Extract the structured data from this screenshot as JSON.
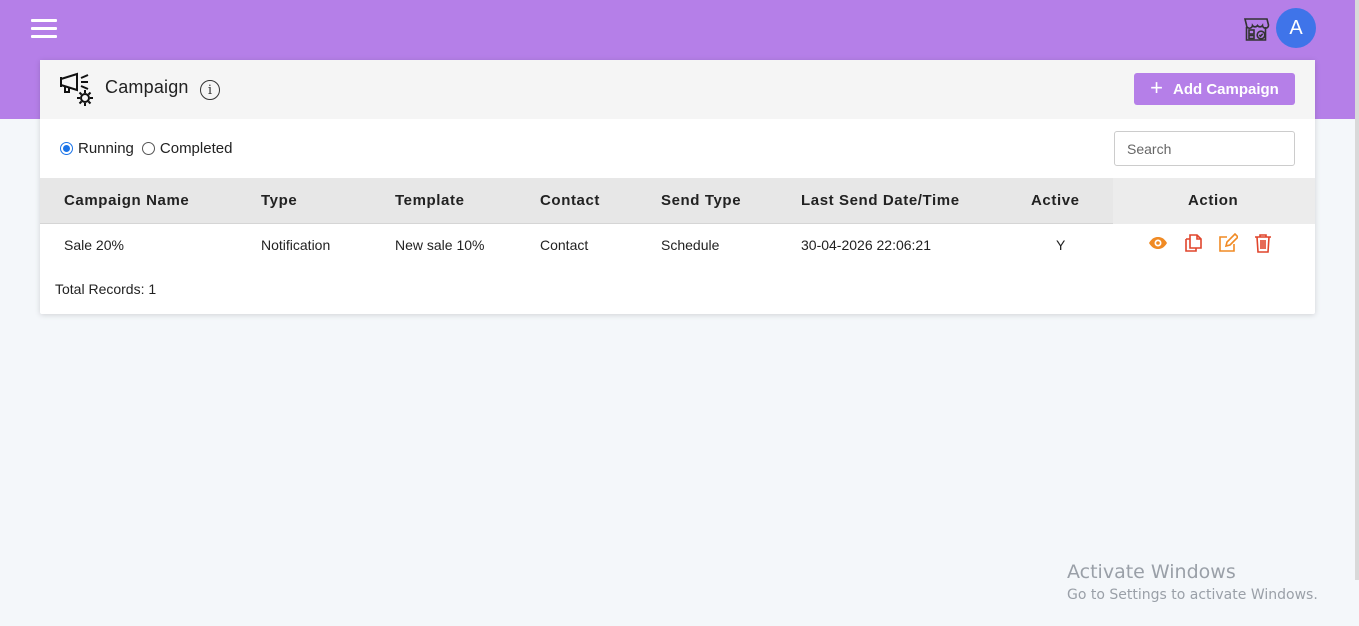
{
  "header": {
    "menu_icon": "hamburger-icon",
    "store_icon": "store-icon",
    "avatar_letter": "A"
  },
  "page": {
    "icon": "megaphone-gear-icon",
    "title": "Campaign",
    "info_glyph": "i",
    "add_button_plus": "+",
    "add_button_label": "Add Campaign"
  },
  "filters": {
    "options": [
      {
        "label": "Running",
        "checked": true
      },
      {
        "label": "Completed",
        "checked": false
      }
    ],
    "search_placeholder": "Search"
  },
  "table": {
    "columns": [
      "Campaign Name",
      "Type",
      "Template",
      "Contact",
      "Send Type",
      "Last Send Date/Time",
      "Active",
      "Action"
    ],
    "rows": [
      {
        "campaign_name": "Sale 20%",
        "type": "Notification",
        "template": "New sale 10%",
        "contact": "Contact",
        "send_type": "Schedule",
        "last_send": "30-04-2026 22:06:21",
        "active": "Y",
        "actions": [
          "eye-icon",
          "copy-icon",
          "edit-icon",
          "delete-icon"
        ]
      }
    ],
    "total_records": "Total Records: 1"
  },
  "colors": {
    "brand": "#b57fe8",
    "avatar": "#3f74e9",
    "action_orange": "#f08a24",
    "action_red": "#e0452c"
  },
  "watermark": {
    "title": "Activate Windows",
    "subtitle": "Go to Settings to activate Windows."
  }
}
